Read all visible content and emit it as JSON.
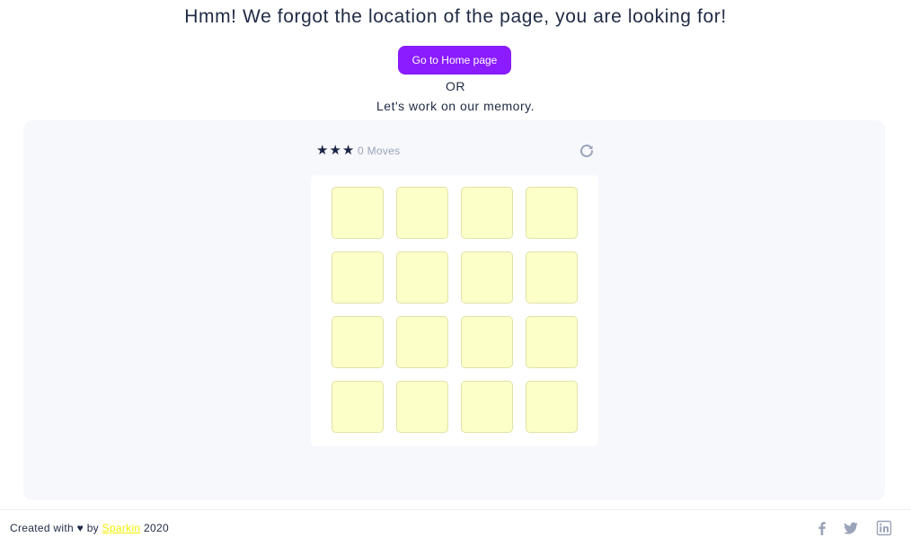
{
  "header": {
    "message": "Hmm! We forgot the location of the page, you are looking for!",
    "home_button_label": "Go to Home page",
    "or_text": "OR",
    "memory_text": "Let's work on our memory."
  },
  "game": {
    "stars": "★★★",
    "star_count": 3,
    "moves_label": "0 Moves",
    "restart_icon": "restart-icon",
    "card_color": "#fdffc9",
    "grid": {
      "rows": 4,
      "cols": 4
    }
  },
  "footer": {
    "credit_prefix": "Created with",
    "heart": "♥",
    "credit_by": "by",
    "brand": "Sparkin",
    "year": "2020",
    "social_icons": [
      "facebook-icon",
      "twitter-icon",
      "linkedin-icon"
    ]
  },
  "colors": {
    "accent": "#8a1cff",
    "brand_link": "#f2f000",
    "panel_bg": "#f7f8fc",
    "text": "#1f2a44"
  }
}
